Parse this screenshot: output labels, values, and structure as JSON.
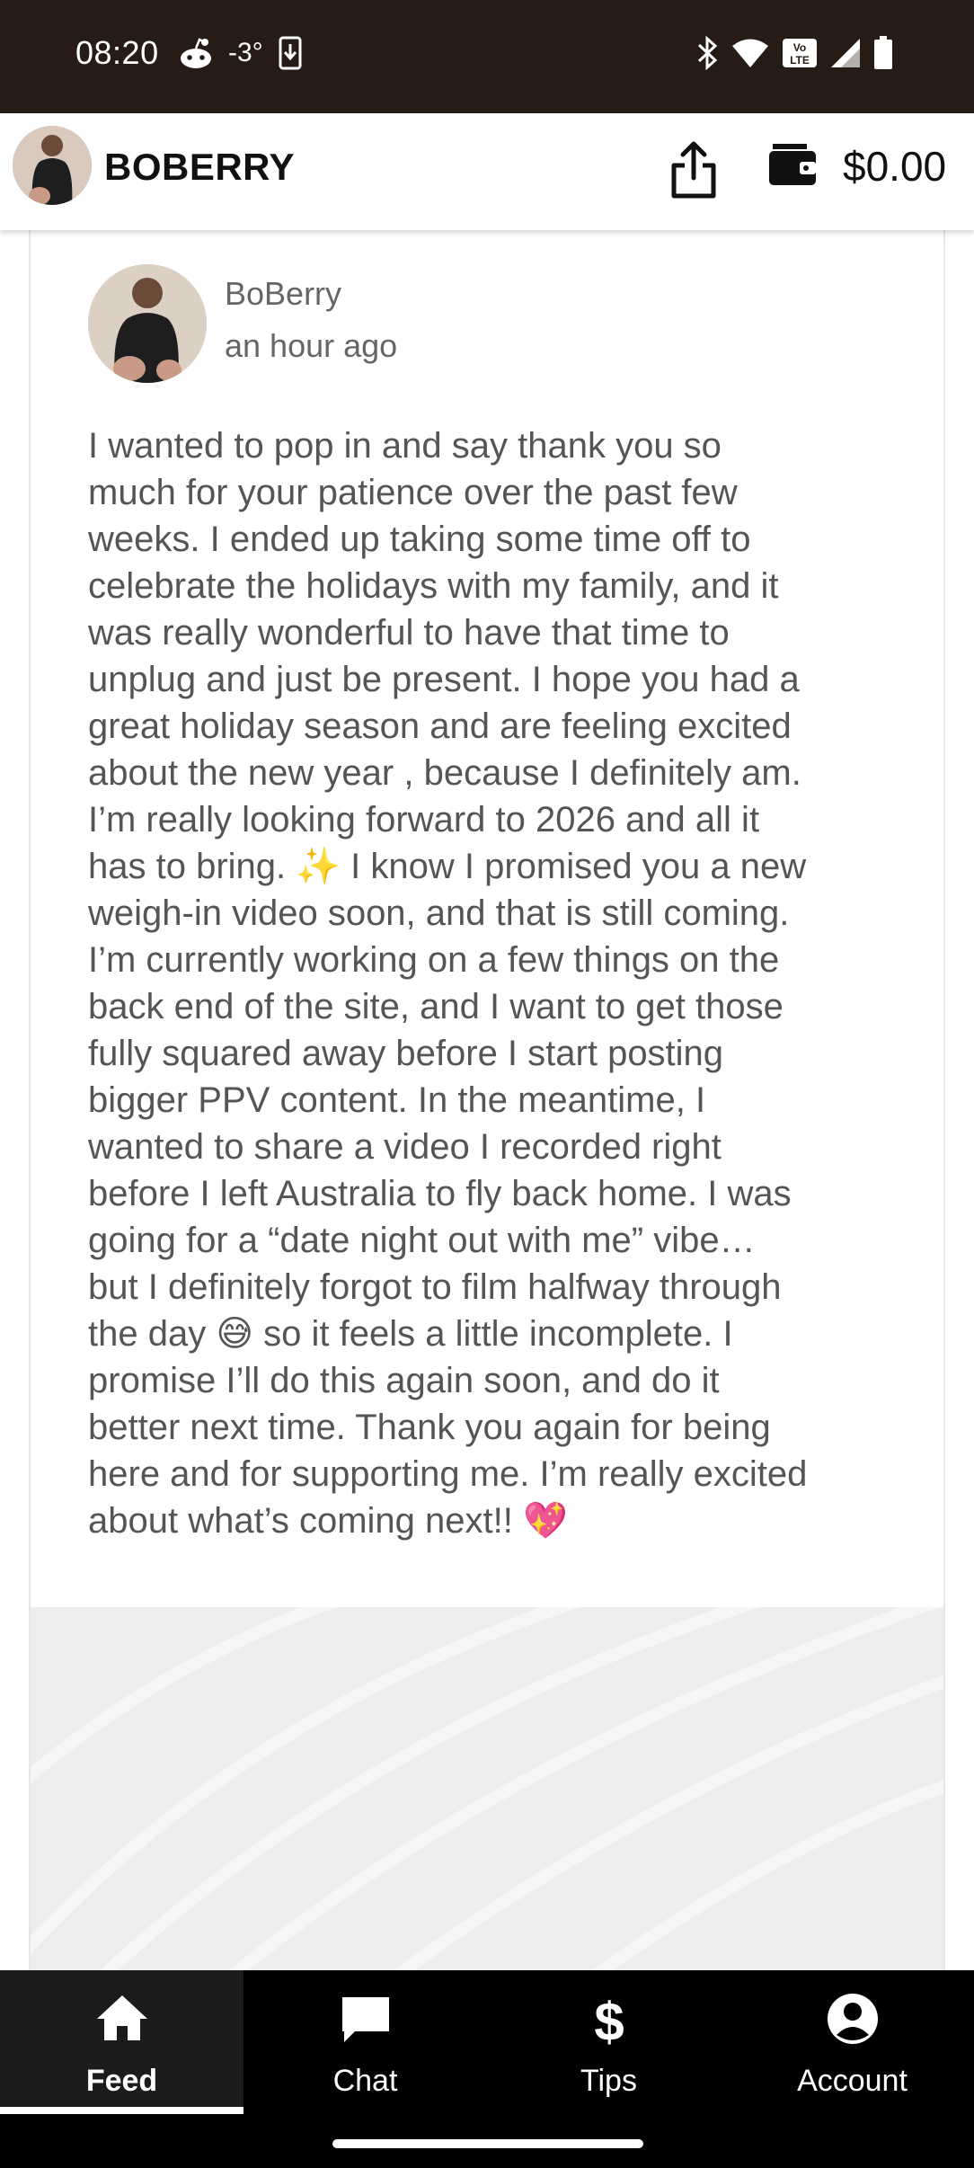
{
  "status_bar": {
    "time": "08:20",
    "temperature": "-3°",
    "volte_label": "Vo LTE",
    "icons": [
      "reddit-icon",
      "download-icon",
      "bluetooth-icon",
      "wifi-icon",
      "volte-icon",
      "signal-icon",
      "battery-icon"
    ]
  },
  "header": {
    "creator_name": "BOBERRY",
    "balance": "$0.00",
    "icons": [
      "share-icon",
      "wallet-icon"
    ]
  },
  "post": {
    "author": "BoBerry",
    "timestamp": "an hour ago",
    "body": "I wanted to pop in and say thank you so\nmuch for your patience over the past few\nweeks. I ended up taking some time off to\ncelebrate the holidays with my family, and it\nwas really wonderful to have that time to\nunplug and just be present. I hope you had a\ngreat holiday season and are feeling excited\nabout the new year , because I definitely am.\nI’m really looking forward to 2026 and all it\nhas to bring. ✨ I know I promised you a new\nweigh-in video soon, and that is still coming.\nI’m currently working on a few things on the\nback end of the site, and I want to get those\nfully squared away before I start posting\nbigger PPV content. In the meantime, I\nwanted to share a video I recorded right\nbefore I left Australia to fly back home. I was\ngoing for a “date night out with me” vibe…\nbut I definitely forgot to film halfway through\nthe day 😅 so it feels a little incomplete. I\npromise I’ll do this again soon, and do it\nbetter next time. Thank you again for being\nhere and for supporting me. I’m really excited\nabout what’s coming next!! 💖"
  },
  "nav": {
    "items": [
      {
        "label": "Feed",
        "icon": "home-icon",
        "active": true
      },
      {
        "label": "Chat",
        "icon": "chat-icon",
        "active": false
      },
      {
        "label": "Tips",
        "icon": "dollar-icon",
        "active": false
      },
      {
        "label": "Account",
        "icon": "account-icon",
        "active": false
      }
    ]
  },
  "colors": {
    "status_bar_bg": "#261c15",
    "nav_bg": "#000000",
    "body_text": "#555555"
  }
}
